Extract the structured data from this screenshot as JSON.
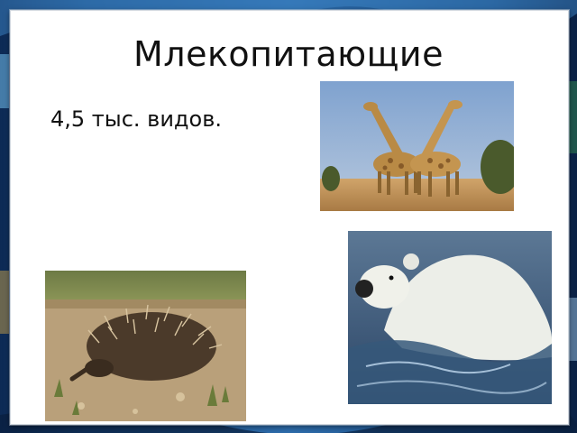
{
  "slide": {
    "title": "Млекопитающие",
    "bullet": "4,5 тыс. видов."
  },
  "images": {
    "giraffes": "giraffes-photo",
    "polar_bear": "polar-bear-photo",
    "echidna": "echidna-photo"
  },
  "colors": {
    "background": "#1c4f86",
    "slide": "#ffffff",
    "text": "#111111"
  }
}
